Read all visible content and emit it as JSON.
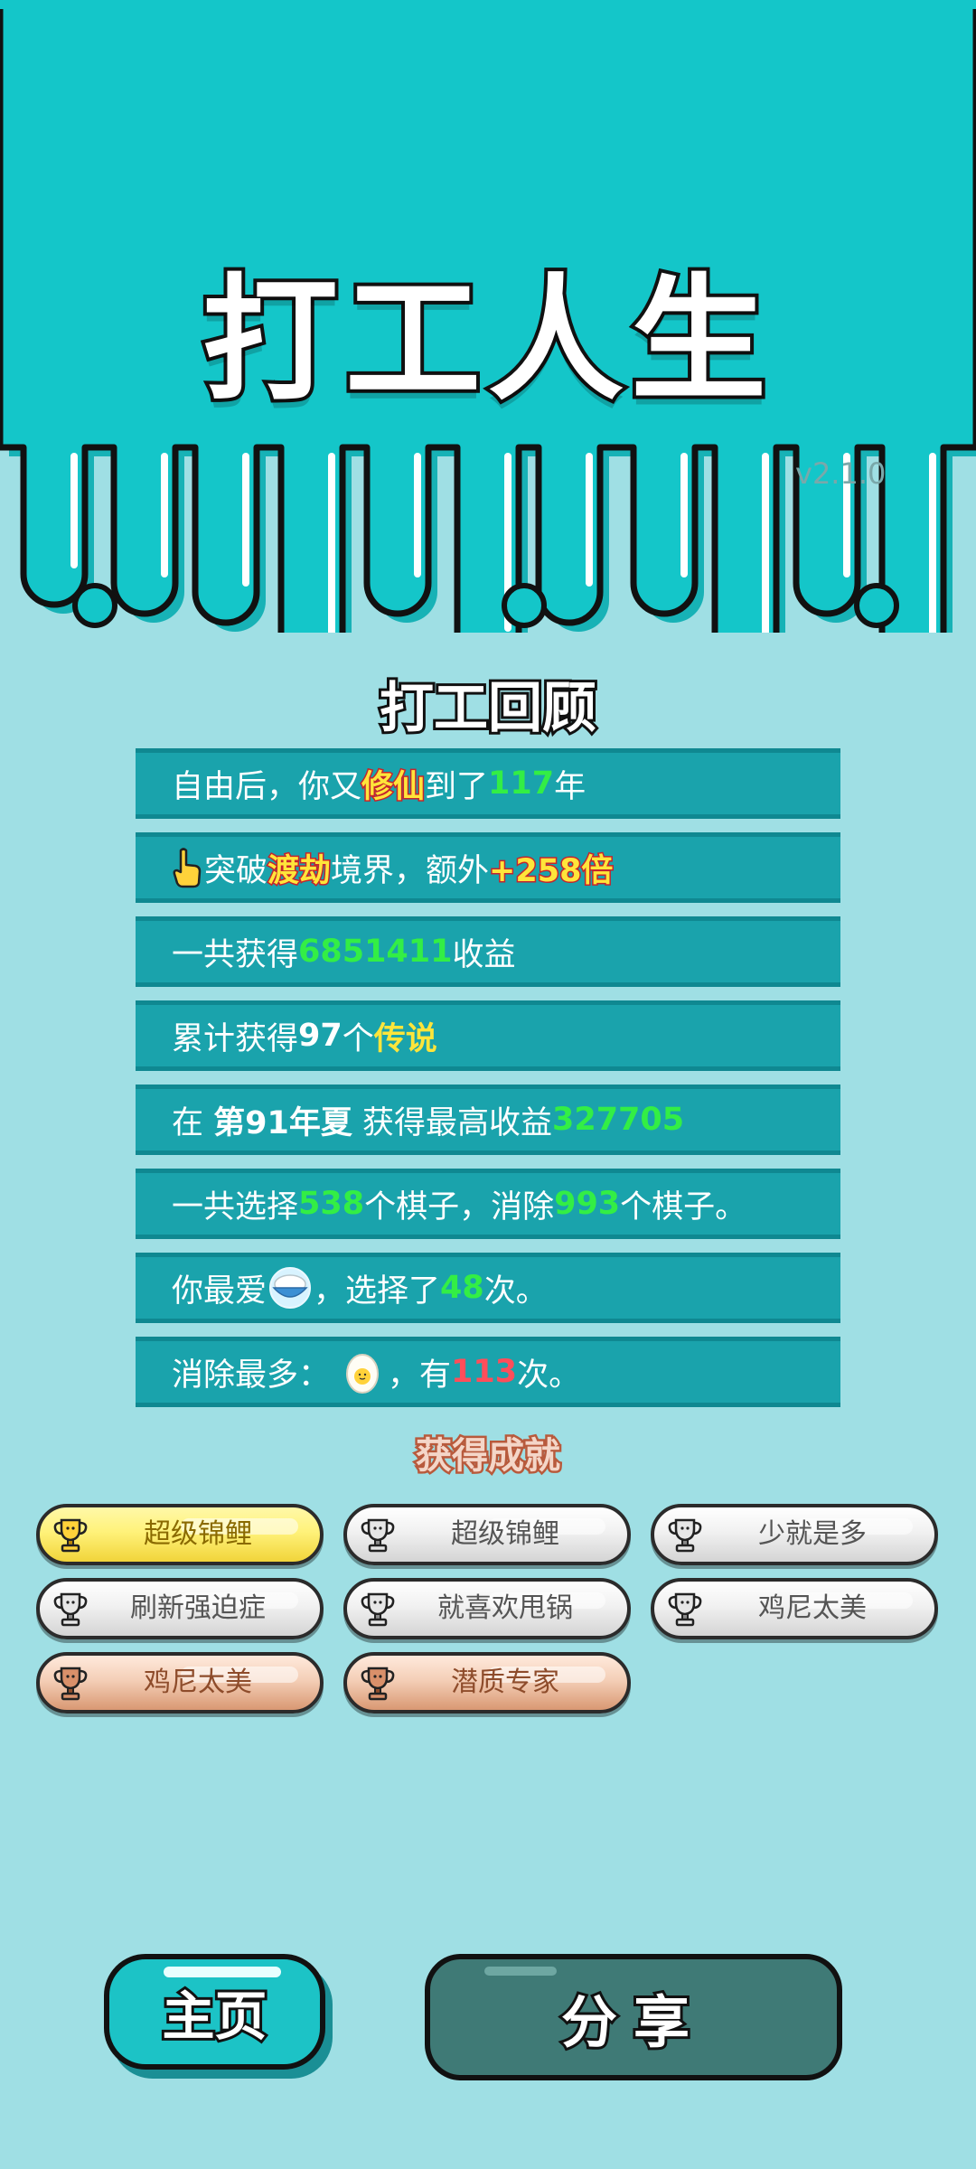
{
  "header": {
    "title": "打工人生",
    "version": "v2.1.0"
  },
  "review": {
    "title": "打工回顾",
    "rows": [
      {
        "segments": [
          {
            "text": "自由后，你又",
            "style": "plain"
          },
          {
            "text": "修仙",
            "style": "yellow"
          },
          {
            "text": "到了",
            "style": "plain"
          },
          {
            "text": "117",
            "style": "green"
          },
          {
            "text": "年",
            "style": "plain"
          }
        ]
      },
      {
        "icon": "pointing-hand-icon",
        "segments": [
          {
            "text": "突破",
            "style": "plain"
          },
          {
            "text": "渡劫",
            "style": "yellow"
          },
          {
            "text": "境界，额外",
            "style": "plain"
          },
          {
            "text": "+258倍",
            "style": "yellow"
          }
        ]
      },
      {
        "segments": [
          {
            "text": "一共获得",
            "style": "plain"
          },
          {
            "text": "6851411",
            "style": "green"
          },
          {
            "text": "收益",
            "style": "plain"
          }
        ]
      },
      {
        "segments": [
          {
            "text": "累计获得",
            "style": "plain"
          },
          {
            "text": "97",
            "style": "white-bold"
          },
          {
            "text": "个",
            "style": "plain"
          },
          {
            "text": "传说",
            "style": "yellow-plain"
          }
        ]
      },
      {
        "segments": [
          {
            "text": "在 ",
            "style": "plain"
          },
          {
            "text": "第91年夏",
            "style": "white-bold"
          },
          {
            "text": " 获得最高收益",
            "style": "plain"
          },
          {
            "text": "327705",
            "style": "green"
          }
        ]
      },
      {
        "segments": [
          {
            "text": "一共选择",
            "style": "plain"
          },
          {
            "text": "538",
            "style": "green"
          },
          {
            "text": "个棋子，消除",
            "style": "plain"
          },
          {
            "text": "993",
            "style": "green"
          },
          {
            "text": "个棋子。",
            "style": "plain"
          }
        ]
      },
      {
        "segments": [
          {
            "text": "你最爱",
            "style": "plain"
          },
          {
            "icon": "rice-bowl-icon"
          },
          {
            "text": "，选择了",
            "style": "plain"
          },
          {
            "text": "48",
            "style": "green"
          },
          {
            "text": "次。",
            "style": "plain"
          }
        ]
      },
      {
        "segments": [
          {
            "text": "消除最多：",
            "style": "plain"
          },
          {
            "icon": "egg-icon"
          },
          {
            "text": "，有",
            "style": "plain"
          },
          {
            "text": "113",
            "style": "red"
          },
          {
            "text": "次。",
            "style": "plain"
          }
        ]
      }
    ]
  },
  "achievements": {
    "title": "获得成就",
    "items": [
      {
        "label": "超级锦鲤",
        "tier": "gold"
      },
      {
        "label": "超级锦鲤",
        "tier": "silver"
      },
      {
        "label": "少就是多",
        "tier": "silver"
      },
      {
        "label": "刷新强迫症",
        "tier": "silver"
      },
      {
        "label": "就喜欢甩锅",
        "tier": "silver"
      },
      {
        "label": "鸡尼太美",
        "tier": "silver"
      },
      {
        "label": "鸡尼太美",
        "tier": "bronze"
      },
      {
        "label": "潜质专家",
        "tier": "bronze"
      }
    ]
  },
  "buttons": {
    "home_label": "主页",
    "share_label": "分享"
  },
  "colors": {
    "header_bg": "#14c6c9",
    "page_bg": "#9fdfe4",
    "row_bg": "#1aa3ac",
    "share_bg": "#3f7a76"
  }
}
